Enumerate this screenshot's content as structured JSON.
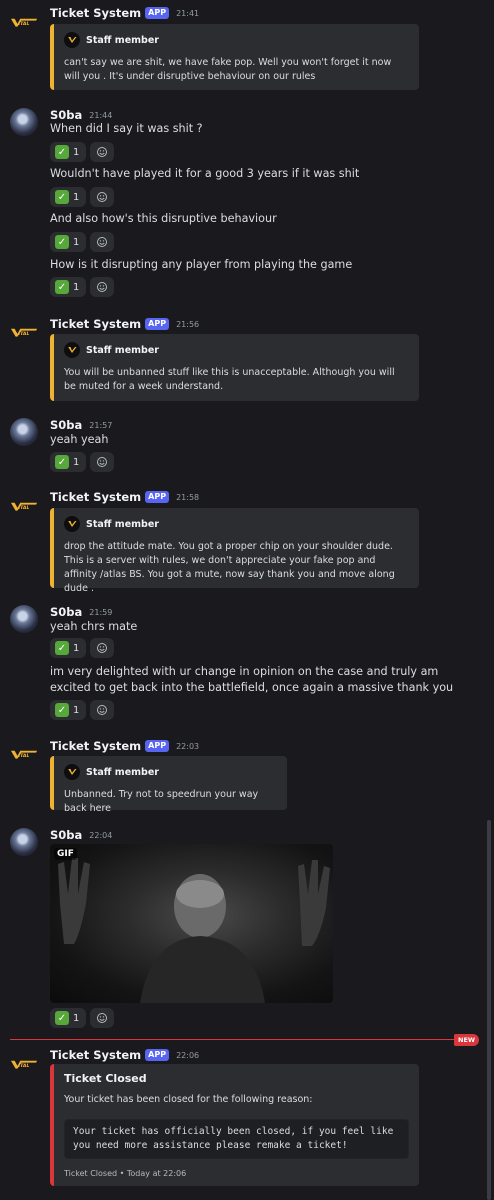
{
  "messages": {
    "m1": {
      "author": "Ticket System",
      "tag": "APP",
      "time": "21:41",
      "embed_author": "Staff member",
      "embed_text": "can't say we are shit, we have fake pop. Well you won't forget it now will you . It's under disruptive behaviour on our rules"
    },
    "m2": {
      "author": "S0ba",
      "time": "21:44",
      "lines": [
        "When did I say it was shit ?",
        "Wouldn't have played it for a good 3 years if it was shit",
        "And also how's this disruptive behaviour",
        "How is it disrupting any player from playing the game"
      ]
    },
    "m3": {
      "author": "Ticket System",
      "tag": "APP",
      "time": "21:56",
      "embed_author": "Staff member",
      "embed_text": "You will be unbanned stuff like this is unacceptable. Although you will be muted for a week understand."
    },
    "m4": {
      "author": "S0ba",
      "time": "21:57",
      "lines": [
        "yeah yeah"
      ]
    },
    "m5": {
      "author": "Ticket System",
      "tag": "APP",
      "time": "21:58",
      "embed_author": "Staff member",
      "embed_text": "drop the attitude mate. You got a proper chip on your shoulder dude. This is a server with rules, we don't appreciate your fake pop and affinity /atlas BS. You got a mute, now say thank you and move along dude ."
    },
    "m6": {
      "author": "S0ba",
      "time": "21:59",
      "lines": [
        "yeah chrs mate",
        "im very delighted with ur change in opinion on the case and  truly am excited to get back into the battlefield, once again a massive thank you"
      ]
    },
    "m7": {
      "author": "Ticket System",
      "tag": "APP",
      "time": "22:03",
      "embed_author": "Staff member",
      "embed_text": "Unbanned. Try not to speedrun your way back here"
    },
    "m8": {
      "author": "S0ba",
      "time": "22:04",
      "gif_label": "GIF"
    },
    "m9": {
      "author": "Ticket System",
      "tag": "APP",
      "time": "22:06",
      "embed_title": "Ticket Closed",
      "embed_text": "Your ticket has been closed for the following reason:",
      "code": "Your ticket has officially been closed, if you feel like\nyou need more assistance please remake a ticket!",
      "footer": "Ticket Closed • Today at 22:06"
    }
  },
  "reaction": {
    "emoji": "✓",
    "count": "1"
  },
  "new_badge": "NEW",
  "logo_text": "VITAL",
  "colors": {
    "accent_embed": "#f0b232",
    "closed_embed": "#da373c",
    "app_tag": "#5865f2",
    "check": "#57a83a"
  },
  "icons": [
    "vital-logo-icon",
    "check-emoji-icon",
    "add-reaction-icon"
  ]
}
